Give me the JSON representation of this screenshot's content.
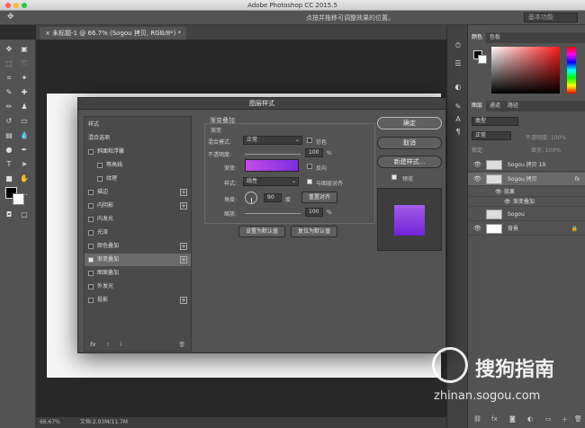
{
  "app_title": "Adobe Photoshop CC 2015.5",
  "options_hint": "点按并拖移可调整效果的位置。",
  "workspace": "基本功能",
  "doc_tab": "未标题-1 @ 66.7% (Sogou 拷贝, RGB/8*) *",
  "status": {
    "zoom": "66.67%",
    "docsize": "文档:2.93M/11.7M"
  },
  "dialog": {
    "title": "图层样式",
    "list": [
      {
        "label": "样式",
        "checkbox": false,
        "checked": false,
        "plus": false,
        "indent": 0
      },
      {
        "label": "混合选项",
        "checkbox": false,
        "checked": false,
        "plus": false,
        "indent": 0
      },
      {
        "label": "斜面和浮雕",
        "checkbox": true,
        "checked": false,
        "plus": false,
        "indent": 0
      },
      {
        "label": "等高线",
        "checkbox": true,
        "checked": false,
        "plus": false,
        "indent": 1
      },
      {
        "label": "纹理",
        "checkbox": true,
        "checked": false,
        "plus": false,
        "indent": 1
      },
      {
        "label": "描边",
        "checkbox": true,
        "checked": false,
        "plus": true,
        "indent": 0
      },
      {
        "label": "内阴影",
        "checkbox": true,
        "checked": false,
        "plus": true,
        "indent": 0
      },
      {
        "label": "内发光",
        "checkbox": true,
        "checked": false,
        "plus": false,
        "indent": 0
      },
      {
        "label": "光泽",
        "checkbox": true,
        "checked": false,
        "plus": false,
        "indent": 0
      },
      {
        "label": "颜色叠加",
        "checkbox": true,
        "checked": false,
        "plus": true,
        "indent": 0
      },
      {
        "label": "渐变叠加",
        "checkbox": true,
        "checked": true,
        "plus": true,
        "indent": 0,
        "selected": true
      },
      {
        "label": "图案叠加",
        "checkbox": true,
        "checked": false,
        "plus": false,
        "indent": 0
      },
      {
        "label": "外发光",
        "checkbox": true,
        "checked": false,
        "plus": false,
        "indent": 0
      },
      {
        "label": "投影",
        "checkbox": true,
        "checked": false,
        "plus": true,
        "indent": 0
      }
    ],
    "list_bottom": "fx",
    "section_title": "渐变叠加",
    "subsection": "渐变",
    "blend_label": "混合模式:",
    "blend_value": "正常",
    "dither_label": "仿色",
    "opacity_label": "不透明度:",
    "opacity_value": "100",
    "percent": "%",
    "gradient_label": "渐变:",
    "reverse_label": "反向",
    "style_label": "样式:",
    "style_value": "线性",
    "align_label": "与图层对齐",
    "angle_label": "角度:",
    "angle_value": "90",
    "degree": "度",
    "reset_align": "重置对齐",
    "scale_label": "缩放:",
    "scale_value": "100",
    "set_default": "设置为默认值",
    "reset_default": "复位为默认值",
    "ok": "确定",
    "cancel": "取消",
    "new_style": "新建样式...",
    "preview_label": "预览"
  },
  "panels": {
    "color_tabs": [
      "颜色",
      "色板"
    ],
    "layer_tabs": [
      "图层",
      "通道",
      "路径"
    ],
    "kind": "类型",
    "blend": "正常",
    "opacity": "不透明度: 100%",
    "fill": "填充: 100%",
    "lock": "锁定:",
    "layers": [
      {
        "name": "Sogou 拷贝 19",
        "fx": false,
        "sel": false
      },
      {
        "name": "Sogou 拷贝",
        "fx": true,
        "sel": true
      },
      {
        "name": "效果",
        "fx": false,
        "sel": false,
        "sub": true
      },
      {
        "name": "渐变叠加",
        "fx": false,
        "sel": false,
        "sub": true
      },
      {
        "name": "Sogou",
        "fx": false,
        "sel": false
      },
      {
        "name": "背景",
        "fx": false,
        "sel": false,
        "bg": true
      }
    ]
  },
  "watermark": {
    "text": "搜狗指南",
    "url": "zhinan.sogou.com"
  },
  "colors": {
    "gradient_start": "#c54ce6",
    "gradient_end": "#7a2de0"
  }
}
